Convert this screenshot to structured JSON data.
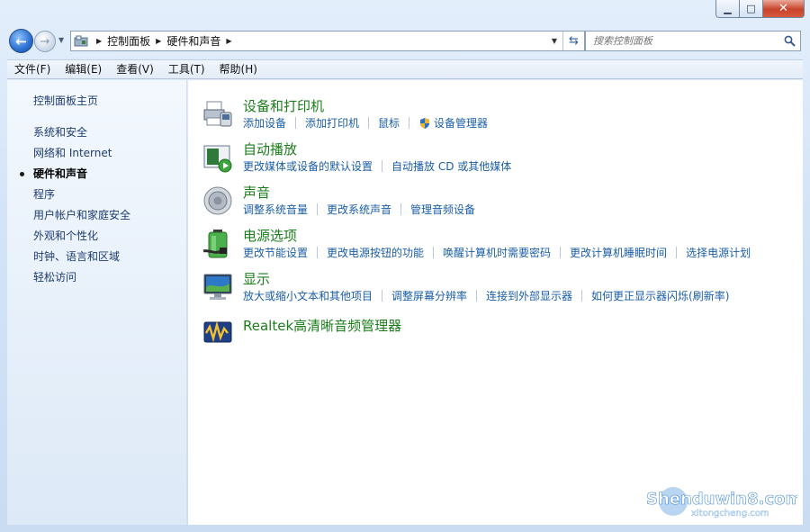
{
  "window": {
    "controls": {
      "minimize": "▁",
      "maximize": "□",
      "close": "✕"
    }
  },
  "address_bar": {
    "crumbs": [
      "控制面板",
      "硬件和声音"
    ],
    "search_placeholder": "搜索控制面板"
  },
  "menu": [
    "文件(F)",
    "编辑(E)",
    "查看(V)",
    "工具(T)",
    "帮助(H)"
  ],
  "sidebar": {
    "home": "控制面板主页",
    "items": [
      {
        "label": "系统和安全",
        "active": false
      },
      {
        "label": "网络和 Internet",
        "active": false
      },
      {
        "label": "硬件和声音",
        "active": true
      },
      {
        "label": "程序",
        "active": false
      },
      {
        "label": "用户帐户和家庭安全",
        "active": false
      },
      {
        "label": "外观和个性化",
        "active": false
      },
      {
        "label": "时钟、语言和区域",
        "active": false
      },
      {
        "label": "轻松访问",
        "active": false
      }
    ]
  },
  "groups": [
    {
      "title": "设备和打印机",
      "icon": "printer-icon",
      "links": [
        "添加设备",
        "添加打印机",
        "鼠标",
        "设备管理器"
      ]
    },
    {
      "title": "自动播放",
      "icon": "autoplay-icon",
      "links": [
        "更改媒体或设备的默认设置",
        "自动播放 CD 或其他媒体"
      ]
    },
    {
      "title": "声音",
      "icon": "speaker-icon",
      "links": [
        "调整系统音量",
        "更改系统声音",
        "管理音频设备"
      ]
    },
    {
      "title": "电源选项",
      "icon": "battery-icon",
      "links": [
        "更改节能设置",
        "更改电源按钮的功能",
        "唤醒计算机时需要密码",
        "更改计算机睡眠时间",
        "选择电源计划"
      ]
    },
    {
      "title": "显示",
      "icon": "monitor-icon",
      "links": [
        "放大或缩小文本和其他项目",
        "调整屏幕分辨率",
        "连接到外部显示器",
        "如何更正显示器闪烁(刷新率)"
      ]
    },
    {
      "title": "Realtek高清晰音频管理器",
      "icon": "realtek-audio-icon",
      "links": []
    }
  ],
  "watermark": {
    "main": "Shenduwin8.com",
    "sub": "xitongcheng.com"
  },
  "colors": {
    "link": "#1b5ea8",
    "group_title": "#1b7d1b",
    "sidebar_link": "#1e3c6e"
  }
}
